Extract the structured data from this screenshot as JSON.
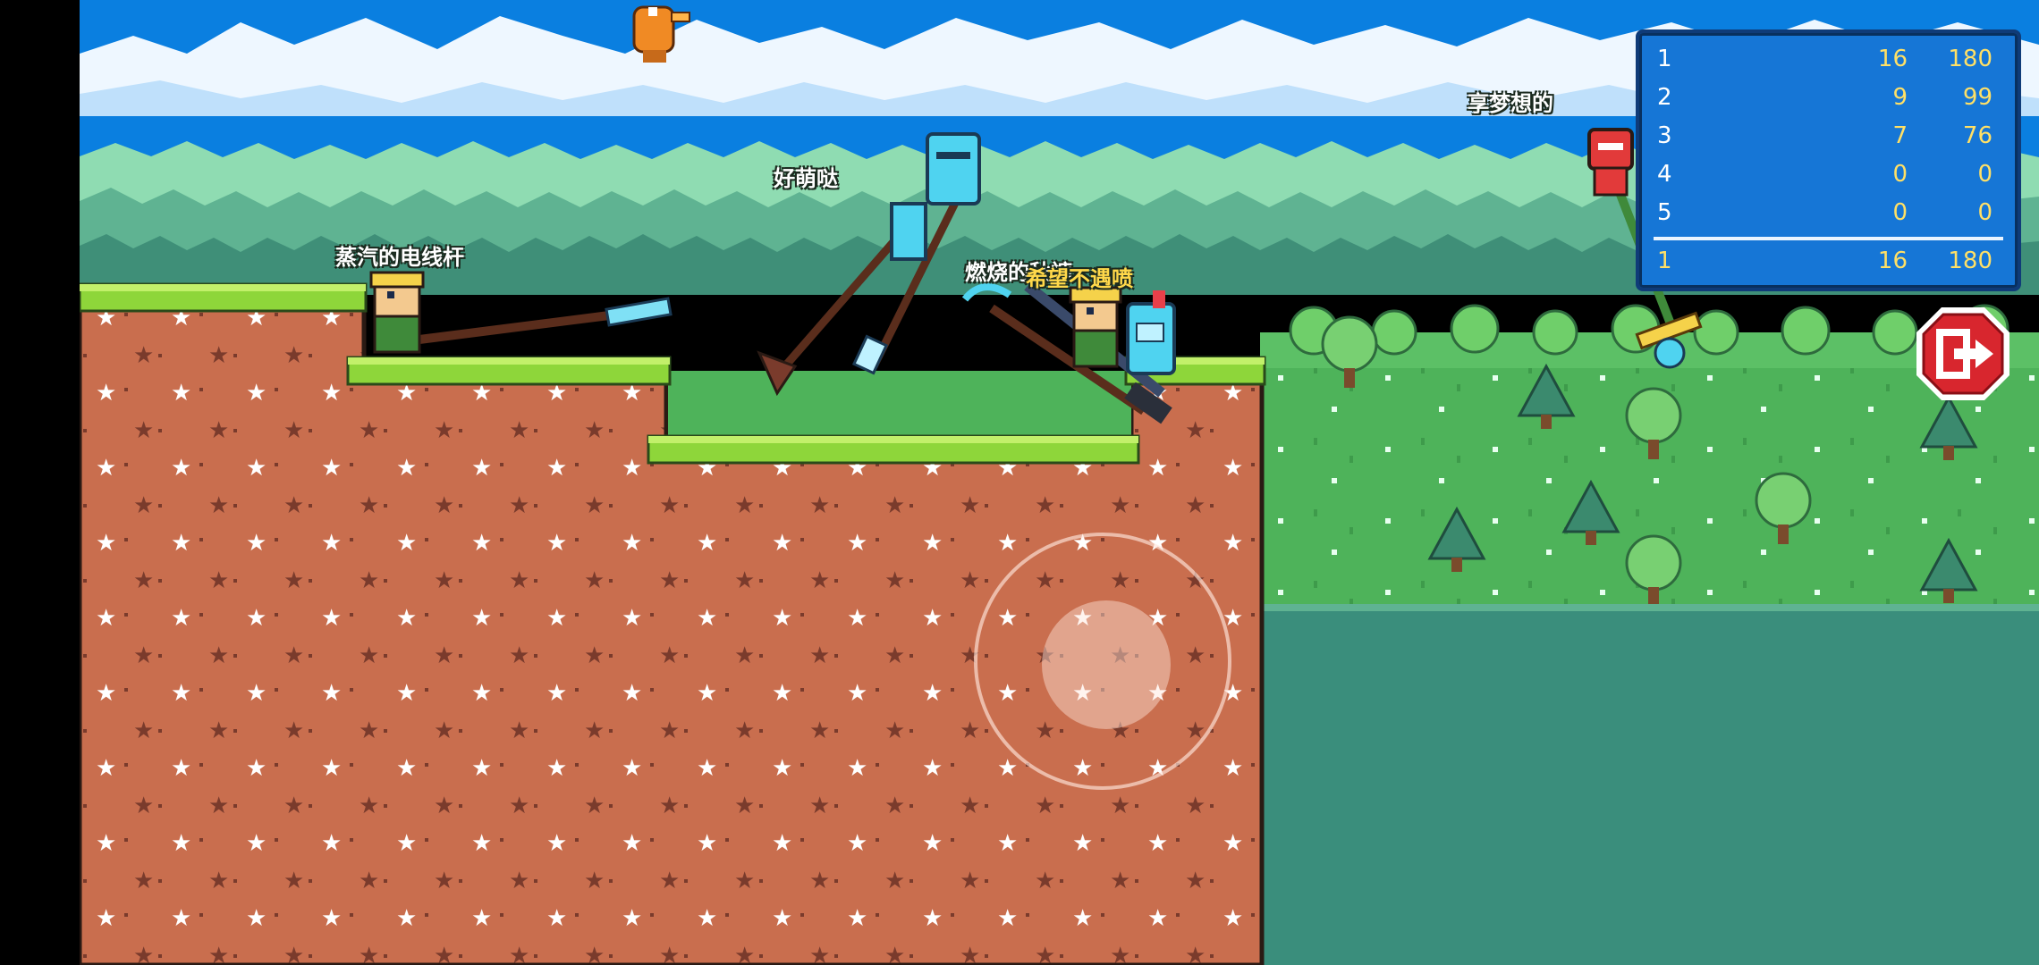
{
  "players": {
    "left": "蒸汽的电线杆",
    "middle_top": "好萌哒",
    "center": "燃烧的秋裤",
    "self": "希望不遇喷",
    "right": "享梦想的"
  },
  "scoreboard": {
    "rows": [
      {
        "rank": "1",
        "kills": "16",
        "score": "180"
      },
      {
        "rank": "2",
        "kills": "9",
        "score": "99"
      },
      {
        "rank": "3",
        "kills": "7",
        "score": "76"
      },
      {
        "rank": "4",
        "kills": "0",
        "score": "0"
      },
      {
        "rank": "5",
        "kills": "0",
        "score": "0"
      }
    ],
    "own": {
      "rank": "1",
      "kills": "16",
      "score": "180"
    }
  },
  "controls": {
    "exit_icon": "exit-door-arrow-icon",
    "joystick": "virtual-joystick"
  },
  "colors": {
    "sky": "#0a7fe0",
    "dirt": "#c96e4e",
    "grass": "#8ed63a",
    "meadow": "#4eb35a",
    "water": "#3a8e7c",
    "scoreboard": "#1676d6",
    "highlight": "#ffe066"
  }
}
